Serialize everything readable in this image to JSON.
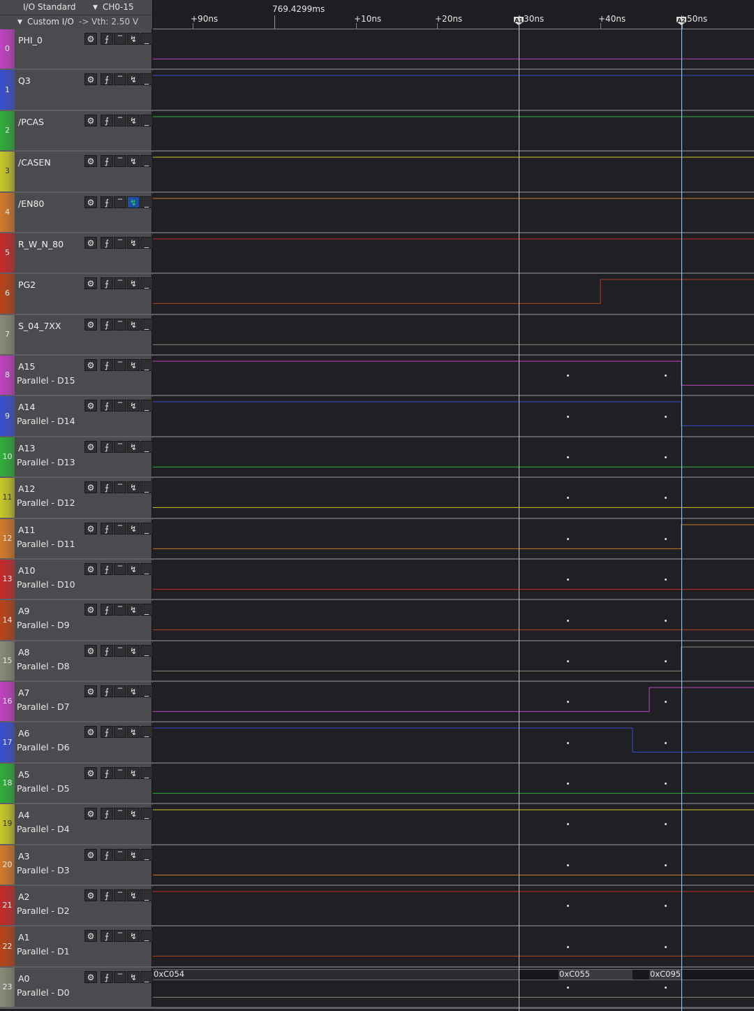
{
  "header": {
    "io_standard": "I/O Standard",
    "channels": "CH0-15",
    "custom_io": "Custom I/O",
    "arrow": "->",
    "vth": "Vth: 2.50 V",
    "ruler_time": "769.4299ms"
  },
  "ruler_ticks": [
    {
      "label": "+90ns"
    },
    {
      "label": "+10ns"
    },
    {
      "label": "+20ns"
    },
    {
      "label": "+30ns"
    },
    {
      "label": "+40ns"
    },
    {
      "label": "+50ns"
    }
  ],
  "cursors": [
    {
      "name": "A1"
    },
    {
      "name": "A2"
    }
  ],
  "channels": [
    {
      "num": "0",
      "label": "PHI_0",
      "sub": "",
      "color": "#c042c0"
    },
    {
      "num": "1",
      "label": "Q3",
      "sub": "",
      "color": "#3a4fd0"
    },
    {
      "num": "2",
      "label": "/PCAS",
      "sub": "",
      "color": "#2fae3a"
    },
    {
      "num": "3",
      "label": "/CASEN",
      "sub": "",
      "color": "#c9c92a"
    },
    {
      "num": "4",
      "label": "/EN80",
      "sub": "",
      "color": "#d27a2a"
    },
    {
      "num": "5",
      "label": "R_W_N_80",
      "sub": "",
      "color": "#c62a2a"
    },
    {
      "num": "6",
      "label": "PG2",
      "sub": "",
      "color": "#b84318"
    },
    {
      "num": "7",
      "label": "S_04_7XX",
      "sub": "",
      "color": "#8a8a78"
    },
    {
      "num": "8",
      "label": "A15",
      "sub": "Parallel - D15",
      "color": "#c042c0"
    },
    {
      "num": "9",
      "label": "A14",
      "sub": "Parallel - D14",
      "color": "#3a4fd0"
    },
    {
      "num": "10",
      "label": "A13",
      "sub": "Parallel - D13",
      "color": "#2fae3a"
    },
    {
      "num": "11",
      "label": "A12",
      "sub": "Parallel - D12",
      "color": "#c9c92a"
    },
    {
      "num": "12",
      "label": "A11",
      "sub": "Parallel - D11",
      "color": "#d27a2a"
    },
    {
      "num": "13",
      "label": "A10",
      "sub": "Parallel - D10",
      "color": "#c62a2a"
    },
    {
      "num": "14",
      "label": "A9",
      "sub": "Parallel - D9",
      "color": "#b84318"
    },
    {
      "num": "15",
      "label": "A8",
      "sub": "Parallel - D8",
      "color": "#8a8a78"
    },
    {
      "num": "16",
      "label": "A7",
      "sub": "Parallel - D7",
      "color": "#c042c0"
    },
    {
      "num": "17",
      "label": "A6",
      "sub": "Parallel - D6",
      "color": "#3a4fd0"
    },
    {
      "num": "18",
      "label": "A5",
      "sub": "Parallel - D5",
      "color": "#2fae3a"
    },
    {
      "num": "19",
      "label": "A4",
      "sub": "Parallel - D4",
      "color": "#c9c92a"
    },
    {
      "num": "20",
      "label": "A3",
      "sub": "Parallel - D3",
      "color": "#d27a2a"
    },
    {
      "num": "21",
      "label": "A2",
      "sub": "Parallel - D2",
      "color": "#c62a2a"
    },
    {
      "num": "22",
      "label": "A1",
      "sub": "Parallel - D1",
      "color": "#b84318"
    },
    {
      "num": "23",
      "label": "A0",
      "sub": "Parallel - D0",
      "color": "#8a8a78"
    }
  ],
  "controls": {
    "gear": "⚙",
    "rise": "⨍",
    "high": "‾",
    "fall": "↯",
    "low": "_"
  },
  "bus_values": [
    "0xC054",
    "0xC055",
    "0xC095"
  ]
}
